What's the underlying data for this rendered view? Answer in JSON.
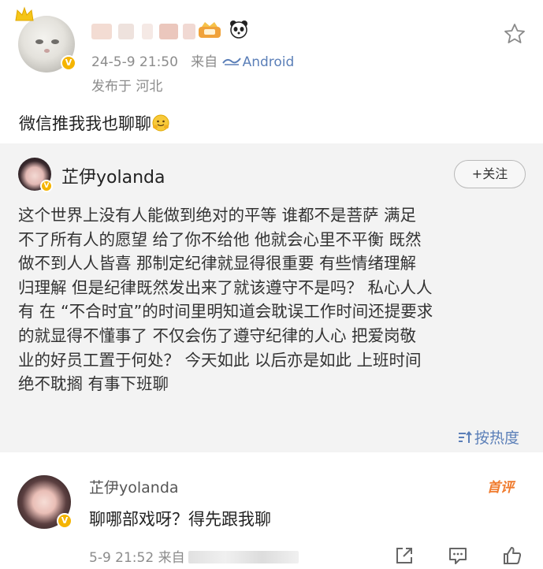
{
  "post": {
    "timestamp": "24-5-9 21:50",
    "source_prefix": "来自",
    "source": "Android",
    "location": "发布于 河北",
    "text": "微信推我我也聊聊"
  },
  "repost": {
    "author": "芷伊yolanda",
    "follow_label": "+关注",
    "lines": [
      "这个世界上没有人能做到绝对的平等 谁都不是菩萨 满足",
      "不了所有人的愿望 给了你不给他 他就会心里不平衡  既然",
      "做不到人人皆喜 那制定纪律就显得很重要 有些情绪理解",
      "归理解 但是纪律既然发出来了就该遵守不是吗？ 私心人人",
      "有 在 “不合时宜”的时间里明知道会耽误工作时间还提要求",
      "的就显得不懂事了 不仅会伤了遵守纪律的人心 把爱岗敬",
      "业的好员工置于何处？ 今天如此 以后亦是如此 上班时间",
      "绝不耽搁  有事下班聊"
    ]
  },
  "sort": {
    "label": "按热度"
  },
  "comment": {
    "author": "芷伊yolanda",
    "badge": "首评",
    "text": "聊哪部戏呀？得先跟我聊",
    "time": "5-9 21:52",
    "source_prefix": "来自"
  },
  "colors": {
    "link": "#5b7fb8",
    "verified": "#f5b400",
    "first_comment": "#f07b2e"
  }
}
